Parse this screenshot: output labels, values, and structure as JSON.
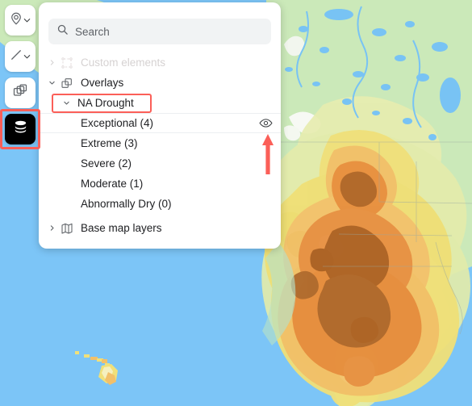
{
  "app": {
    "name": "map-layers-panel",
    "ocean_color": "#7cc5f7",
    "land_color": "#cbe9b9",
    "panel_background": "#ffffff",
    "annotation_color": "#fb5f58"
  },
  "toolbar": {
    "items": [
      {
        "id": "place-marker",
        "icon": "map-pin-icon",
        "label": "",
        "has_caret": true,
        "active": false
      },
      {
        "id": "line-tool",
        "icon": "line-icon",
        "label": "",
        "has_caret": true,
        "active": false
      },
      {
        "id": "duplicate-tool",
        "icon": "copy-layers-icon",
        "label": "",
        "has_caret": false,
        "active": false
      },
      {
        "id": "layers-tool",
        "icon": "stacked-layers-icon",
        "label": "",
        "has_caret": false,
        "active": true
      }
    ]
  },
  "panel": {
    "search": {
      "placeholder": "Search",
      "value": "",
      "icon": "search-icon"
    },
    "tree": {
      "custom_elements": {
        "label": "Custom elements",
        "icon": "dashed-square-icon",
        "twisty": "›",
        "expanded": false,
        "disabled": true
      },
      "overlays": {
        "label": "Overlays",
        "icon": "copy-layers-icon",
        "twisty": "⌄",
        "expanded": true
      },
      "na_drought": {
        "label": "NA Drought",
        "twisty": "⌄",
        "expanded": true,
        "highlighted": true
      },
      "drought_levels": [
        {
          "label": "Exceptional (4)",
          "hovered": true,
          "eye_icon": "eye-icon"
        },
        {
          "label": "Extreme (3)",
          "hovered": false,
          "eye_icon": "eye-icon"
        },
        {
          "label": "Severe (2)",
          "hovered": false,
          "eye_icon": "eye-icon"
        },
        {
          "label": "Moderate (1)",
          "hovered": false,
          "eye_icon": "eye-icon"
        },
        {
          "label": "Abnormally Dry (0)",
          "hovered": false,
          "eye_icon": "eye-icon"
        }
      ],
      "base_map_layers": {
        "label": "Base map layers",
        "icon": "folded-map-icon",
        "twisty": "›",
        "expanded": false
      }
    }
  },
  "annotations": {
    "arrow": {
      "name": "red-arrow-up",
      "points_to": "eye-icon",
      "color": "#fb5f58"
    },
    "layers_button_box": {
      "name": "red-box-layers-button",
      "color": "#fb5f58"
    },
    "na_drought_box": {
      "name": "red-box-na-drought",
      "color": "#fb5f58"
    }
  }
}
